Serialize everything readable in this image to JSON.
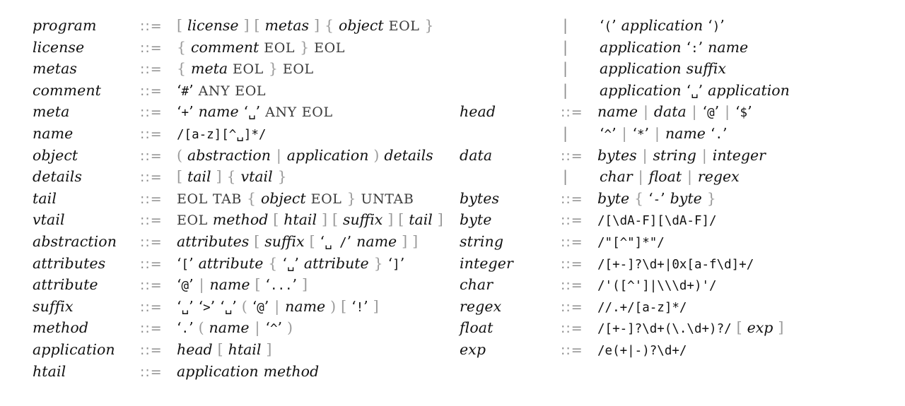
{
  "document": {
    "kind": "ebnf-grammar",
    "notation": {
      "define": "::=",
      "alternative": "|"
    },
    "colors": {
      "text": "#111111",
      "meta": "#9a9a9a",
      "terminal": "#3b3b3b",
      "background": "#ffffff"
    }
  },
  "left_column": [
    {
      "name": "program",
      "def": "::=",
      "rhs": [
        {
          "t": "meta",
          "v": "["
        },
        {
          "t": "nt",
          "v": "license"
        },
        {
          "t": "meta",
          "v": "]"
        },
        {
          "t": "meta",
          "v": "["
        },
        {
          "t": "nt",
          "v": "metas"
        },
        {
          "t": "meta",
          "v": "]"
        },
        {
          "t": "meta",
          "v": "{"
        },
        {
          "t": "nt",
          "v": "object"
        },
        {
          "t": "term",
          "v": "EOL"
        },
        {
          "t": "meta",
          "v": "}"
        }
      ]
    },
    {
      "name": "license",
      "def": "::=",
      "rhs": [
        {
          "t": "meta",
          "v": "{"
        },
        {
          "t": "nt",
          "v": "comment"
        },
        {
          "t": "term",
          "v": "EOL"
        },
        {
          "t": "meta",
          "v": "}"
        },
        {
          "t": "term",
          "v": "EOL"
        }
      ]
    },
    {
      "name": "metas",
      "def": "::=",
      "rhs": [
        {
          "t": "meta",
          "v": "{"
        },
        {
          "t": "nt",
          "v": "meta"
        },
        {
          "t": "term",
          "v": "EOL"
        },
        {
          "t": "meta",
          "v": "}"
        },
        {
          "t": "term",
          "v": "EOL"
        }
      ]
    },
    {
      "name": "comment",
      "def": "::=",
      "rhs": [
        {
          "t": "lit",
          "v": "#"
        },
        {
          "t": "term",
          "v": "ANY"
        },
        {
          "t": "term",
          "v": "EOL"
        }
      ]
    },
    {
      "name": "meta",
      "def": "::=",
      "rhs": [
        {
          "t": "lit",
          "v": "+"
        },
        {
          "t": "nt",
          "v": "name"
        },
        {
          "t": "lit",
          "v": "␣"
        },
        {
          "t": "term",
          "v": "ANY"
        },
        {
          "t": "term",
          "v": "EOL"
        }
      ]
    },
    {
      "name": "name",
      "def": "::=",
      "rhs": [
        {
          "t": "rx",
          "v": "/[a-z][^␣]*/"
        }
      ]
    },
    {
      "name": "object",
      "def": "::=",
      "rhs": [
        {
          "t": "meta",
          "v": "("
        },
        {
          "t": "nt",
          "v": "abstraction"
        },
        {
          "t": "alt",
          "v": "|"
        },
        {
          "t": "nt",
          "v": "application"
        },
        {
          "t": "meta",
          "v": ")"
        },
        {
          "t": "nt",
          "v": "details"
        }
      ]
    },
    {
      "name": "details",
      "def": "::=",
      "rhs": [
        {
          "t": "meta",
          "v": "["
        },
        {
          "t": "nt",
          "v": "tail"
        },
        {
          "t": "meta",
          "v": "]"
        },
        {
          "t": "meta",
          "v": "{"
        },
        {
          "t": "nt",
          "v": "vtail"
        },
        {
          "t": "meta",
          "v": "}"
        }
      ]
    },
    {
      "name": "tail",
      "def": "::=",
      "rhs": [
        {
          "t": "term",
          "v": "EOL"
        },
        {
          "t": "term",
          "v": "TAB"
        },
        {
          "t": "meta",
          "v": "{"
        },
        {
          "t": "nt",
          "v": "object"
        },
        {
          "t": "term",
          "v": "EOL"
        },
        {
          "t": "meta",
          "v": "}"
        },
        {
          "t": "term",
          "v": "UNTAB"
        }
      ]
    },
    {
      "name": "vtail",
      "def": "::=",
      "rhs": [
        {
          "t": "term",
          "v": "EOL"
        },
        {
          "t": "nt",
          "v": "method"
        },
        {
          "t": "meta",
          "v": "["
        },
        {
          "t": "nt",
          "v": "htail"
        },
        {
          "t": "meta",
          "v": "]"
        },
        {
          "t": "meta",
          "v": "["
        },
        {
          "t": "nt",
          "v": "suffix"
        },
        {
          "t": "meta",
          "v": "]"
        },
        {
          "t": "meta",
          "v": "["
        },
        {
          "t": "nt",
          "v": "tail"
        },
        {
          "t": "meta",
          "v": "]"
        }
      ]
    },
    {
      "name": "abstraction",
      "def": "::=",
      "rhs": [
        {
          "t": "nt",
          "v": "attributes"
        },
        {
          "t": "meta",
          "v": "["
        },
        {
          "t": "nt",
          "v": "suffix"
        },
        {
          "t": "meta",
          "v": "["
        },
        {
          "t": "lit",
          "v": "␣ /"
        },
        {
          "t": "nt",
          "v": "name"
        },
        {
          "t": "meta",
          "v": "]"
        },
        {
          "t": "meta",
          "v": "]"
        }
      ]
    },
    {
      "name": "attributes",
      "def": "::=",
      "rhs": [
        {
          "t": "lit",
          "v": "["
        },
        {
          "t": "nt",
          "v": "attribute"
        },
        {
          "t": "meta",
          "v": "{"
        },
        {
          "t": "lit",
          "v": "␣"
        },
        {
          "t": "nt",
          "v": "attribute"
        },
        {
          "t": "meta",
          "v": "}"
        },
        {
          "t": "lit",
          "v": "]"
        }
      ]
    },
    {
      "name": "attribute",
      "def": "::=",
      "rhs": [
        {
          "t": "lit",
          "v": "@"
        },
        {
          "t": "alt",
          "v": "|"
        },
        {
          "t": "nt",
          "v": "name"
        },
        {
          "t": "meta",
          "v": "["
        },
        {
          "t": "lit",
          "v": "..."
        },
        {
          "t": "meta",
          "v": "]"
        }
      ]
    },
    {
      "name": "suffix",
      "def": "::=",
      "rhs": [
        {
          "t": "lit",
          "v": "␣"
        },
        {
          "t": "lit",
          "v": ">"
        },
        {
          "t": "lit",
          "v": "␣"
        },
        {
          "t": "meta",
          "v": "("
        },
        {
          "t": "lit",
          "v": "@"
        },
        {
          "t": "alt",
          "v": "|"
        },
        {
          "t": "nt",
          "v": "name"
        },
        {
          "t": "meta",
          "v": ")"
        },
        {
          "t": "meta",
          "v": "["
        },
        {
          "t": "lit",
          "v": "!"
        },
        {
          "t": "meta",
          "v": "]"
        }
      ]
    },
    {
      "name": "method",
      "def": "::=",
      "rhs": [
        {
          "t": "lit",
          "v": "."
        },
        {
          "t": "meta",
          "v": "("
        },
        {
          "t": "nt",
          "v": "name"
        },
        {
          "t": "alt",
          "v": "|"
        },
        {
          "t": "lit",
          "v": "^"
        },
        {
          "t": "meta",
          "v": ")"
        }
      ]
    },
    {
      "name": "application",
      "def": "::=",
      "rhs": [
        {
          "t": "nt",
          "v": "head"
        },
        {
          "t": "meta",
          "v": "["
        },
        {
          "t": "nt",
          "v": "htail"
        },
        {
          "t": "meta",
          "v": "]"
        }
      ]
    },
    {
      "name": "htail",
      "def": "::=",
      "rhs": [
        {
          "t": "nt",
          "v": "application"
        },
        {
          "t": "nt",
          "v": "method"
        }
      ]
    }
  ],
  "right_column": [
    {
      "name": "",
      "def": "|",
      "rhs": [
        {
          "t": "lit",
          "v": "("
        },
        {
          "t": "nt",
          "v": "application"
        },
        {
          "t": "lit",
          "v": ")"
        }
      ]
    },
    {
      "name": "",
      "def": "|",
      "rhs": [
        {
          "t": "nt",
          "v": "application"
        },
        {
          "t": "lit",
          "v": ":"
        },
        {
          "t": "nt",
          "v": "name"
        }
      ]
    },
    {
      "name": "",
      "def": "|",
      "rhs": [
        {
          "t": "nt",
          "v": "application"
        },
        {
          "t": "nt",
          "v": "suffix"
        }
      ]
    },
    {
      "name": "",
      "def": "|",
      "rhs": [
        {
          "t": "nt",
          "v": "application"
        },
        {
          "t": "lit",
          "v": "␣"
        },
        {
          "t": "nt",
          "v": "application"
        }
      ]
    },
    {
      "name": "head",
      "def": "::=",
      "rhs": [
        {
          "t": "nt",
          "v": "name"
        },
        {
          "t": "alt",
          "v": "|"
        },
        {
          "t": "nt",
          "v": "data"
        },
        {
          "t": "alt",
          "v": "|"
        },
        {
          "t": "lit",
          "v": "@"
        },
        {
          "t": "alt",
          "v": "|"
        },
        {
          "t": "lit",
          "v": "$"
        }
      ]
    },
    {
      "name": "",
      "def": "|",
      "rhs": [
        {
          "t": "lit",
          "v": "^"
        },
        {
          "t": "alt",
          "v": "|"
        },
        {
          "t": "lit",
          "v": "*"
        },
        {
          "t": "alt",
          "v": "|"
        },
        {
          "t": "nt",
          "v": "name"
        },
        {
          "t": "lit",
          "v": "."
        }
      ]
    },
    {
      "name": "data",
      "def": "::=",
      "rhs": [
        {
          "t": "nt",
          "v": "bytes"
        },
        {
          "t": "alt",
          "v": "|"
        },
        {
          "t": "nt",
          "v": "string"
        },
        {
          "t": "alt",
          "v": "|"
        },
        {
          "t": "nt",
          "v": "integer"
        }
      ]
    },
    {
      "name": "",
      "def": "|",
      "rhs": [
        {
          "t": "nt",
          "v": "char"
        },
        {
          "t": "alt",
          "v": "|"
        },
        {
          "t": "nt",
          "v": "float"
        },
        {
          "t": "alt",
          "v": "|"
        },
        {
          "t": "nt",
          "v": "regex"
        }
      ]
    },
    {
      "name": "bytes",
      "def": "::=",
      "rhs": [
        {
          "t": "nt",
          "v": "byte"
        },
        {
          "t": "meta",
          "v": "{"
        },
        {
          "t": "lit",
          "v": "-"
        },
        {
          "t": "nt",
          "v": "byte"
        },
        {
          "t": "meta",
          "v": "}"
        }
      ]
    },
    {
      "name": "byte",
      "def": "::=",
      "rhs": [
        {
          "t": "rx",
          "v": "/[\\dA-F][\\dA-F]/"
        }
      ]
    },
    {
      "name": "string",
      "def": "::=",
      "rhs": [
        {
          "t": "rx",
          "v": "/\"[^\"]*\"/"
        }
      ]
    },
    {
      "name": "integer",
      "def": "::=",
      "rhs": [
        {
          "t": "rx",
          "v": "/[+-]?\\d+|0x[a-f\\d]+/"
        }
      ]
    },
    {
      "name": "char",
      "def": "::=",
      "rhs": [
        {
          "t": "rx",
          "v": "/'([^']|\\\\\\d+)'/"
        }
      ]
    },
    {
      "name": "regex",
      "def": "::=",
      "rhs": [
        {
          "t": "rx",
          "v": "//.+/[a-z]*/"
        }
      ]
    },
    {
      "name": "float",
      "def": "::=",
      "rhs": [
        {
          "t": "rx",
          "v": "/[+-]?\\d+(\\.\\d+)?/"
        },
        {
          "t": "meta",
          "v": "["
        },
        {
          "t": "nt",
          "v": "exp"
        },
        {
          "t": "meta",
          "v": "]"
        }
      ]
    },
    {
      "name": "exp",
      "def": "::=",
      "rhs": [
        {
          "t": "rx",
          "v": "/e(+|-)?\\d+/"
        }
      ]
    }
  ]
}
